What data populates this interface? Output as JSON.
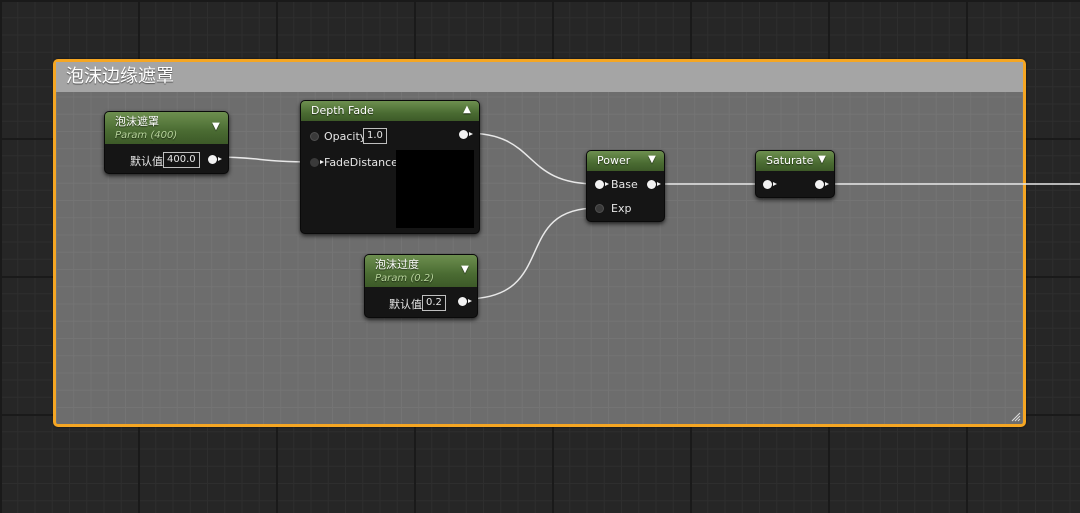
{
  "comment": {
    "title": "泡沫边缘遮罩"
  },
  "nodes": {
    "mask_param": {
      "title": "泡沫遮罩",
      "subtitle": "Param (400)",
      "default_label": "默认值",
      "value": "400.0"
    },
    "depth_fade": {
      "title": "Depth Fade",
      "opacity_label": "Opacity",
      "opacity_value": "1.0",
      "fade_label": "FadeDistance"
    },
    "transition_param": {
      "title": "泡沫过度",
      "subtitle": "Param (0.2)",
      "default_label": "默认值",
      "value": "0.2"
    },
    "power": {
      "title": "Power",
      "base_label": "Base",
      "exp_label": "Exp"
    },
    "saturate": {
      "title": "Saturate"
    }
  },
  "icons": {
    "collapse": "chevron-down-icon",
    "expand": "chevron-up-icon",
    "resize": "resize-grip-icon"
  },
  "colors": {
    "comment_border": "#f5a623",
    "node_header": "#4a6b32",
    "wire": "#e8e8e8"
  }
}
